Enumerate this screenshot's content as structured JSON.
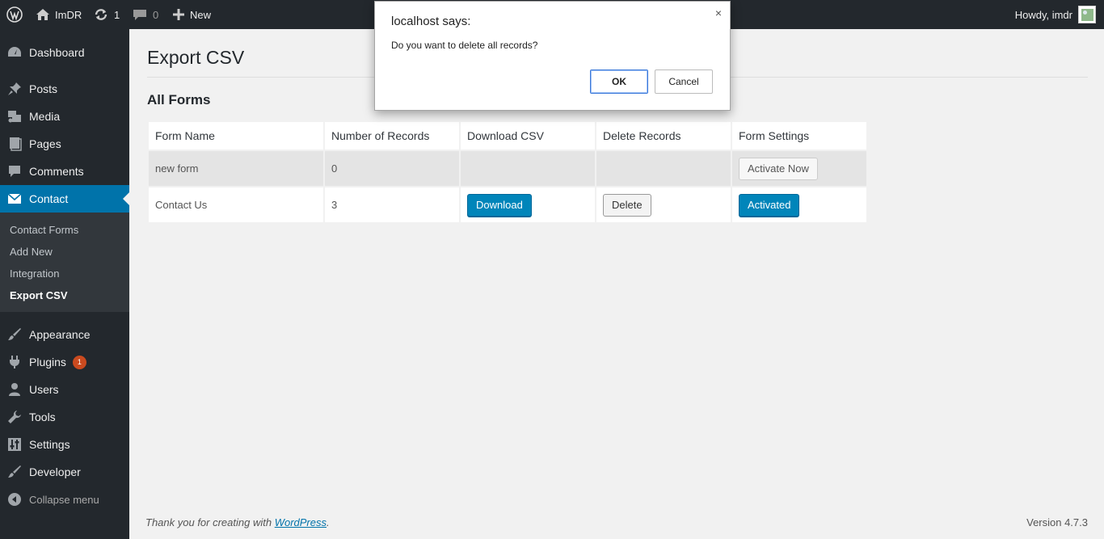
{
  "adminbar": {
    "site_name": "ImDR",
    "updates_count": "1",
    "comments_count": "0",
    "new_label": "New",
    "howdy": "Howdy, imdr"
  },
  "sidebar": {
    "items": [
      {
        "label": "Dashboard",
        "icon": "dashboard-icon"
      },
      {
        "label": "Posts",
        "icon": "pin-icon"
      },
      {
        "label": "Media",
        "icon": "media-icon"
      },
      {
        "label": "Pages",
        "icon": "pages-icon"
      },
      {
        "label": "Comments",
        "icon": "comments-icon"
      },
      {
        "label": "Contact",
        "icon": "mail-icon"
      },
      {
        "label": "Appearance",
        "icon": "brush-icon"
      },
      {
        "label": "Plugins",
        "icon": "plugins-icon",
        "badge": "1"
      },
      {
        "label": "Users",
        "icon": "users-icon"
      },
      {
        "label": "Tools",
        "icon": "wrench-icon"
      },
      {
        "label": "Settings",
        "icon": "settings-icon"
      },
      {
        "label": "Developer",
        "icon": "brush-icon"
      }
    ],
    "submenu": [
      "Contact Forms",
      "Add New",
      "Integration",
      "Export CSV"
    ],
    "collapse_label": "Collapse menu"
  },
  "main": {
    "page_title": "Export CSV",
    "section_title": "All Forms",
    "columns": [
      "Form Name",
      "Number of Records",
      "Download CSV",
      "Delete Records",
      "Form Settings"
    ],
    "rows": [
      {
        "name": "new form",
        "records": "0",
        "settings_label": "Activate Now"
      },
      {
        "name": "Contact Us",
        "records": "3",
        "download_label": "Download",
        "delete_label": "Delete",
        "settings_label": "Activated"
      }
    ]
  },
  "footer": {
    "thanks_prefix": "Thank you for creating with ",
    "link_text": "WordPress",
    "suffix": ".",
    "version": "Version 4.7.3"
  },
  "dialog": {
    "title": "localhost says:",
    "message": "Do you want to delete all records?",
    "ok_label": "OK",
    "cancel_label": "Cancel",
    "close_glyph": "×"
  },
  "colors": {
    "adminbar_bg": "#23282d",
    "menu_current": "#0073aa",
    "primary_button": "#0085ba",
    "badge": "#ca4a1f"
  }
}
